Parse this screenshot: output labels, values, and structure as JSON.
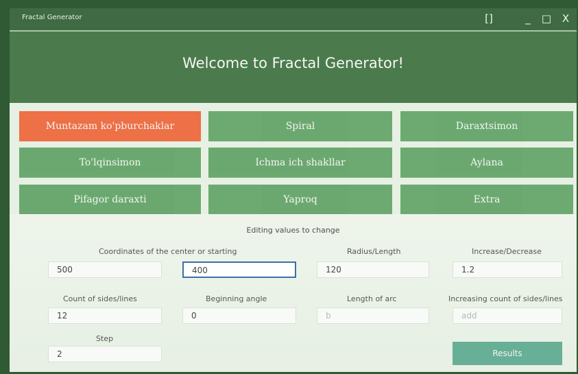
{
  "window": {
    "title": "Fractal Generator",
    "controls": [
      "[]",
      "_",
      "□",
      "X"
    ]
  },
  "header": {
    "welcome": "Welcome to Fractal Generator!"
  },
  "types": {
    "items": [
      "Muntazam ko'pburchaklar",
      "Spiral",
      "Daraxtsimon",
      "To'lqinsimon",
      "Ichma ich shakllar",
      "Aylana",
      "Pifagor daraxti",
      "Yaproq",
      "Extra"
    ]
  },
  "form": {
    "section_label": "Editing values to change",
    "fields": {
      "center_label": "Coordinates of the center or starting",
      "center_x": "500",
      "center_y": "400",
      "radius_label": "Radius/Length",
      "radius": "120",
      "increase_label": "Increase/Decrease",
      "increase": "1.2",
      "count_label": "Count of sides/lines",
      "count": "12",
      "angle_label": "Beginning angle",
      "angle": "0",
      "arc_label": "Length of arc",
      "arc_value": "b",
      "increasing_label": "Increasing count of sides/lines",
      "increasing_value": "add",
      "step_label": "Step",
      "step": "2"
    },
    "results_label": "Results"
  },
  "colors": {
    "selected": "#ee6a3f",
    "button": "#65a56a",
    "header": "#4b7b4d",
    "results": "#67af96"
  }
}
